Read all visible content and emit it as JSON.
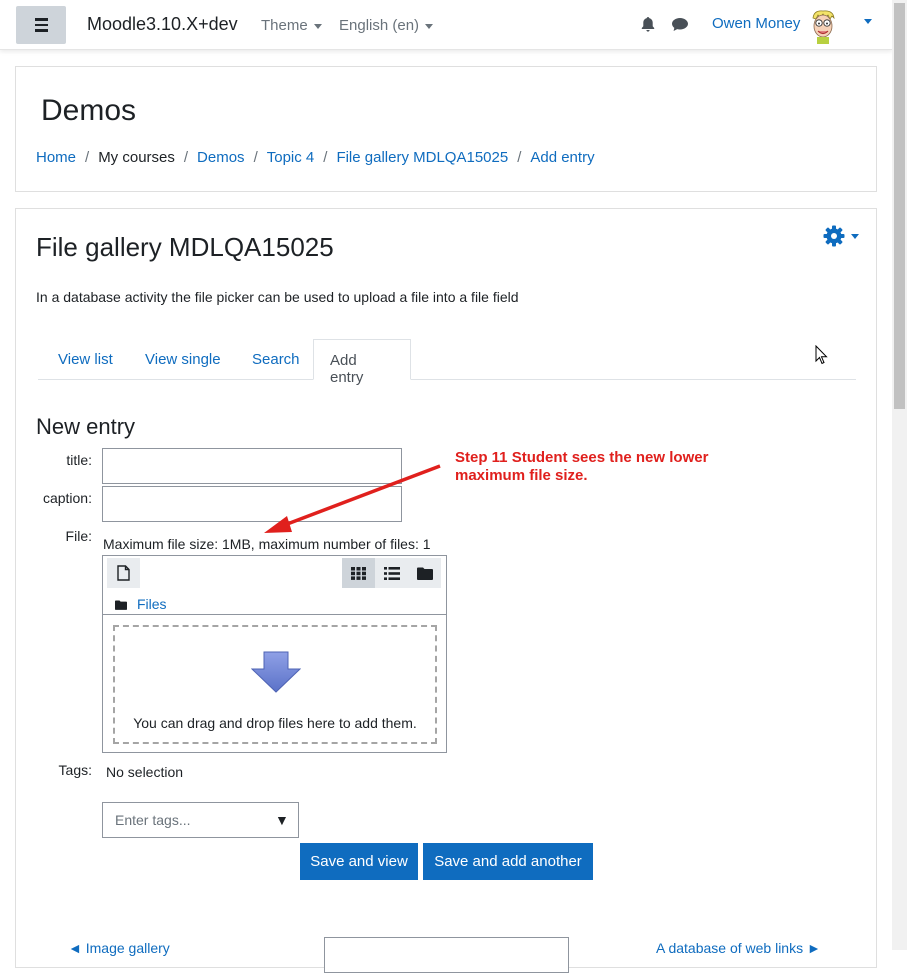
{
  "navbar": {
    "site_name": "Moodle3.10.X+dev",
    "theme_label": "Theme",
    "language_label": "English (en)",
    "user_name": "Owen Money"
  },
  "header": {
    "title": "Demos",
    "breadcrumb": [
      "Home",
      "My courses",
      "Demos",
      "Topic 4",
      "File gallery MDLQA15025",
      "Add entry"
    ]
  },
  "activity": {
    "title": "File gallery MDLQA15025",
    "intro": "In a database activity the file picker can be used to upload a file into a file field",
    "tabs": [
      "View list",
      "View single",
      "Search",
      "Add entry"
    ],
    "active_tab": "Add entry"
  },
  "form": {
    "section_title": "New entry",
    "title_label": "title:",
    "caption_label": "caption:",
    "file_label": "File:",
    "max_size_text": "Maximum file size: 1MB, maximum number of files: 1",
    "files_path": "Files",
    "drop_text": "You can drag and drop files here to add them.",
    "tags_label": "Tags:",
    "tags_value": "No selection",
    "tags_placeholder": "Enter tags...",
    "save_view": "Save and view",
    "save_add": "Save and add another"
  },
  "footer_nav": {
    "prev_link": "◄ Image gallery",
    "next_link": "A database of web links ►"
  },
  "annotation": {
    "line1": "Step 11 Student sees the new lower",
    "line2": "maximum file size.",
    "color": "#e0201d"
  },
  "colors": {
    "link": "#0f6cbf",
    "primary_button": "#0f6cbf",
    "drop_arrow": "#6b83d4"
  },
  "icons": [
    "menu-icon",
    "bell-icon",
    "chat-icon",
    "gear-icon",
    "file-icon",
    "grid-icon",
    "list-icon",
    "folder-icon",
    "down-arrow-icon",
    "cursor-icon"
  ]
}
